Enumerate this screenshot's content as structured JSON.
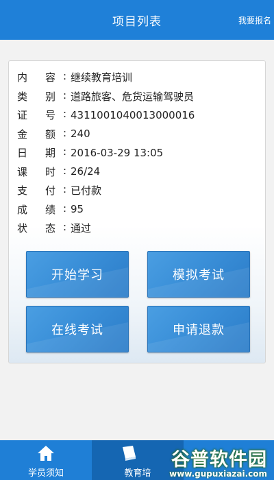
{
  "header": {
    "title": "项目列表",
    "action_label": "我要报名"
  },
  "info": [
    {
      "label": [
        "内",
        "容"
      ],
      "value": "继续教育培训"
    },
    {
      "label": [
        "类",
        "别"
      ],
      "value": "道路旅客、危货运输驾驶员"
    },
    {
      "label": [
        "证",
        "号"
      ],
      "value": "4311001040013000016"
    },
    {
      "label": [
        "金",
        "额"
      ],
      "value": "240"
    },
    {
      "label": [
        "日",
        "期"
      ],
      "value": "2016-03-29 13:05"
    },
    {
      "label": [
        "课",
        "时"
      ],
      "value": "26/24"
    },
    {
      "label": [
        "支",
        "付"
      ],
      "value": "已付款"
    },
    {
      "label": [
        "成",
        "绩"
      ],
      "value": "95"
    },
    {
      "label": [
        "状",
        "态"
      ],
      "value": "通过"
    }
  ],
  "actions": {
    "start_study": "开始学习",
    "mock_exam": "模拟考试",
    "online_exam": "在线考试",
    "refund": "申请退款"
  },
  "tabs": [
    {
      "label": "学员须知",
      "icon": "home-icon"
    },
    {
      "label": "教育培",
      "icon": "book-icon"
    }
  ],
  "watermark": {
    "big": "谷普软件园",
    "small": "www.gupuxiazai.com"
  },
  "colors": {
    "header": "#1f80d8",
    "button": "#3a8fd8",
    "tab_active": "#1566b2"
  }
}
